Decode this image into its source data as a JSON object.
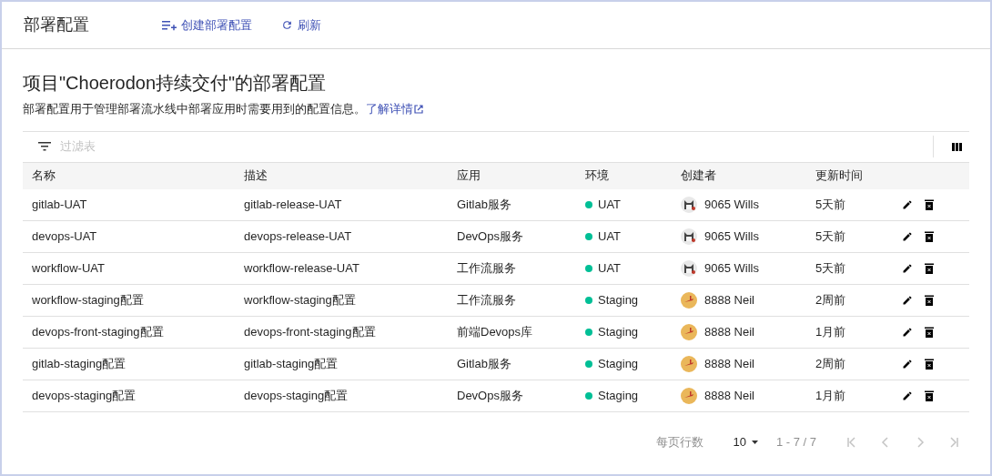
{
  "header": {
    "title": "部署配置",
    "actions": [
      {
        "kind": "create",
        "label": "创建部署配置"
      },
      {
        "kind": "refresh",
        "label": "刷新"
      }
    ]
  },
  "intro": {
    "title": "项目\"Choerodon持续交付\"的部署配置",
    "description": "部署配置用于管理部署流水线中部署应用时需要用到的配置信息。",
    "link": "了解详情"
  },
  "filter": {
    "placeholder": "过滤表"
  },
  "table": {
    "columns": [
      "名称",
      "描述",
      "应用",
      "环境",
      "创建者",
      "更新时间"
    ],
    "rows": [
      {
        "name": "gitlab-UAT",
        "description": "gitlab-release-UAT",
        "app": "Gitlab服务",
        "env": "UAT",
        "kind": "dog",
        "creator": "9065 Wills",
        "updated": "5天前"
      },
      {
        "name": "devops-UAT",
        "description": "devops-release-UAT",
        "app": "DevOps服务",
        "env": "UAT",
        "kind": "dog",
        "creator": "9065 Wills",
        "updated": "5天前"
      },
      {
        "name": "workflow-UAT",
        "description": "workflow-release-UAT",
        "app": "工作流服务",
        "env": "UAT",
        "kind": "dog",
        "creator": "9065 Wills",
        "updated": "5天前"
      },
      {
        "name": "workflow-staging配置",
        "description": "workflow-staging配置",
        "app": "工作流服务",
        "env": "Staging",
        "kind": "plane",
        "creator": "8888 Neil",
        "updated": "2周前"
      },
      {
        "name": "devops-front-staging配置",
        "description": "devops-front-staging配置",
        "app": "前端Devops库",
        "env": "Staging",
        "kind": "plane",
        "creator": "8888 Neil",
        "updated": "1月前"
      },
      {
        "name": "gitlab-staging配置",
        "description": "gitlab-staging配置",
        "app": "Gitlab服务",
        "env": "Staging",
        "kind": "plane",
        "creator": "8888 Neil",
        "updated": "2周前"
      },
      {
        "name": "devops-staging配置",
        "description": "devops-staging配置",
        "app": "DevOps服务",
        "env": "Staging",
        "kind": "plane",
        "creator": "8888 Neil",
        "updated": "1月前"
      }
    ]
  },
  "pagination": {
    "rows_per_page_label": "每页行数",
    "rows_per_page": "10",
    "range": "1 - 7 / 7"
  }
}
